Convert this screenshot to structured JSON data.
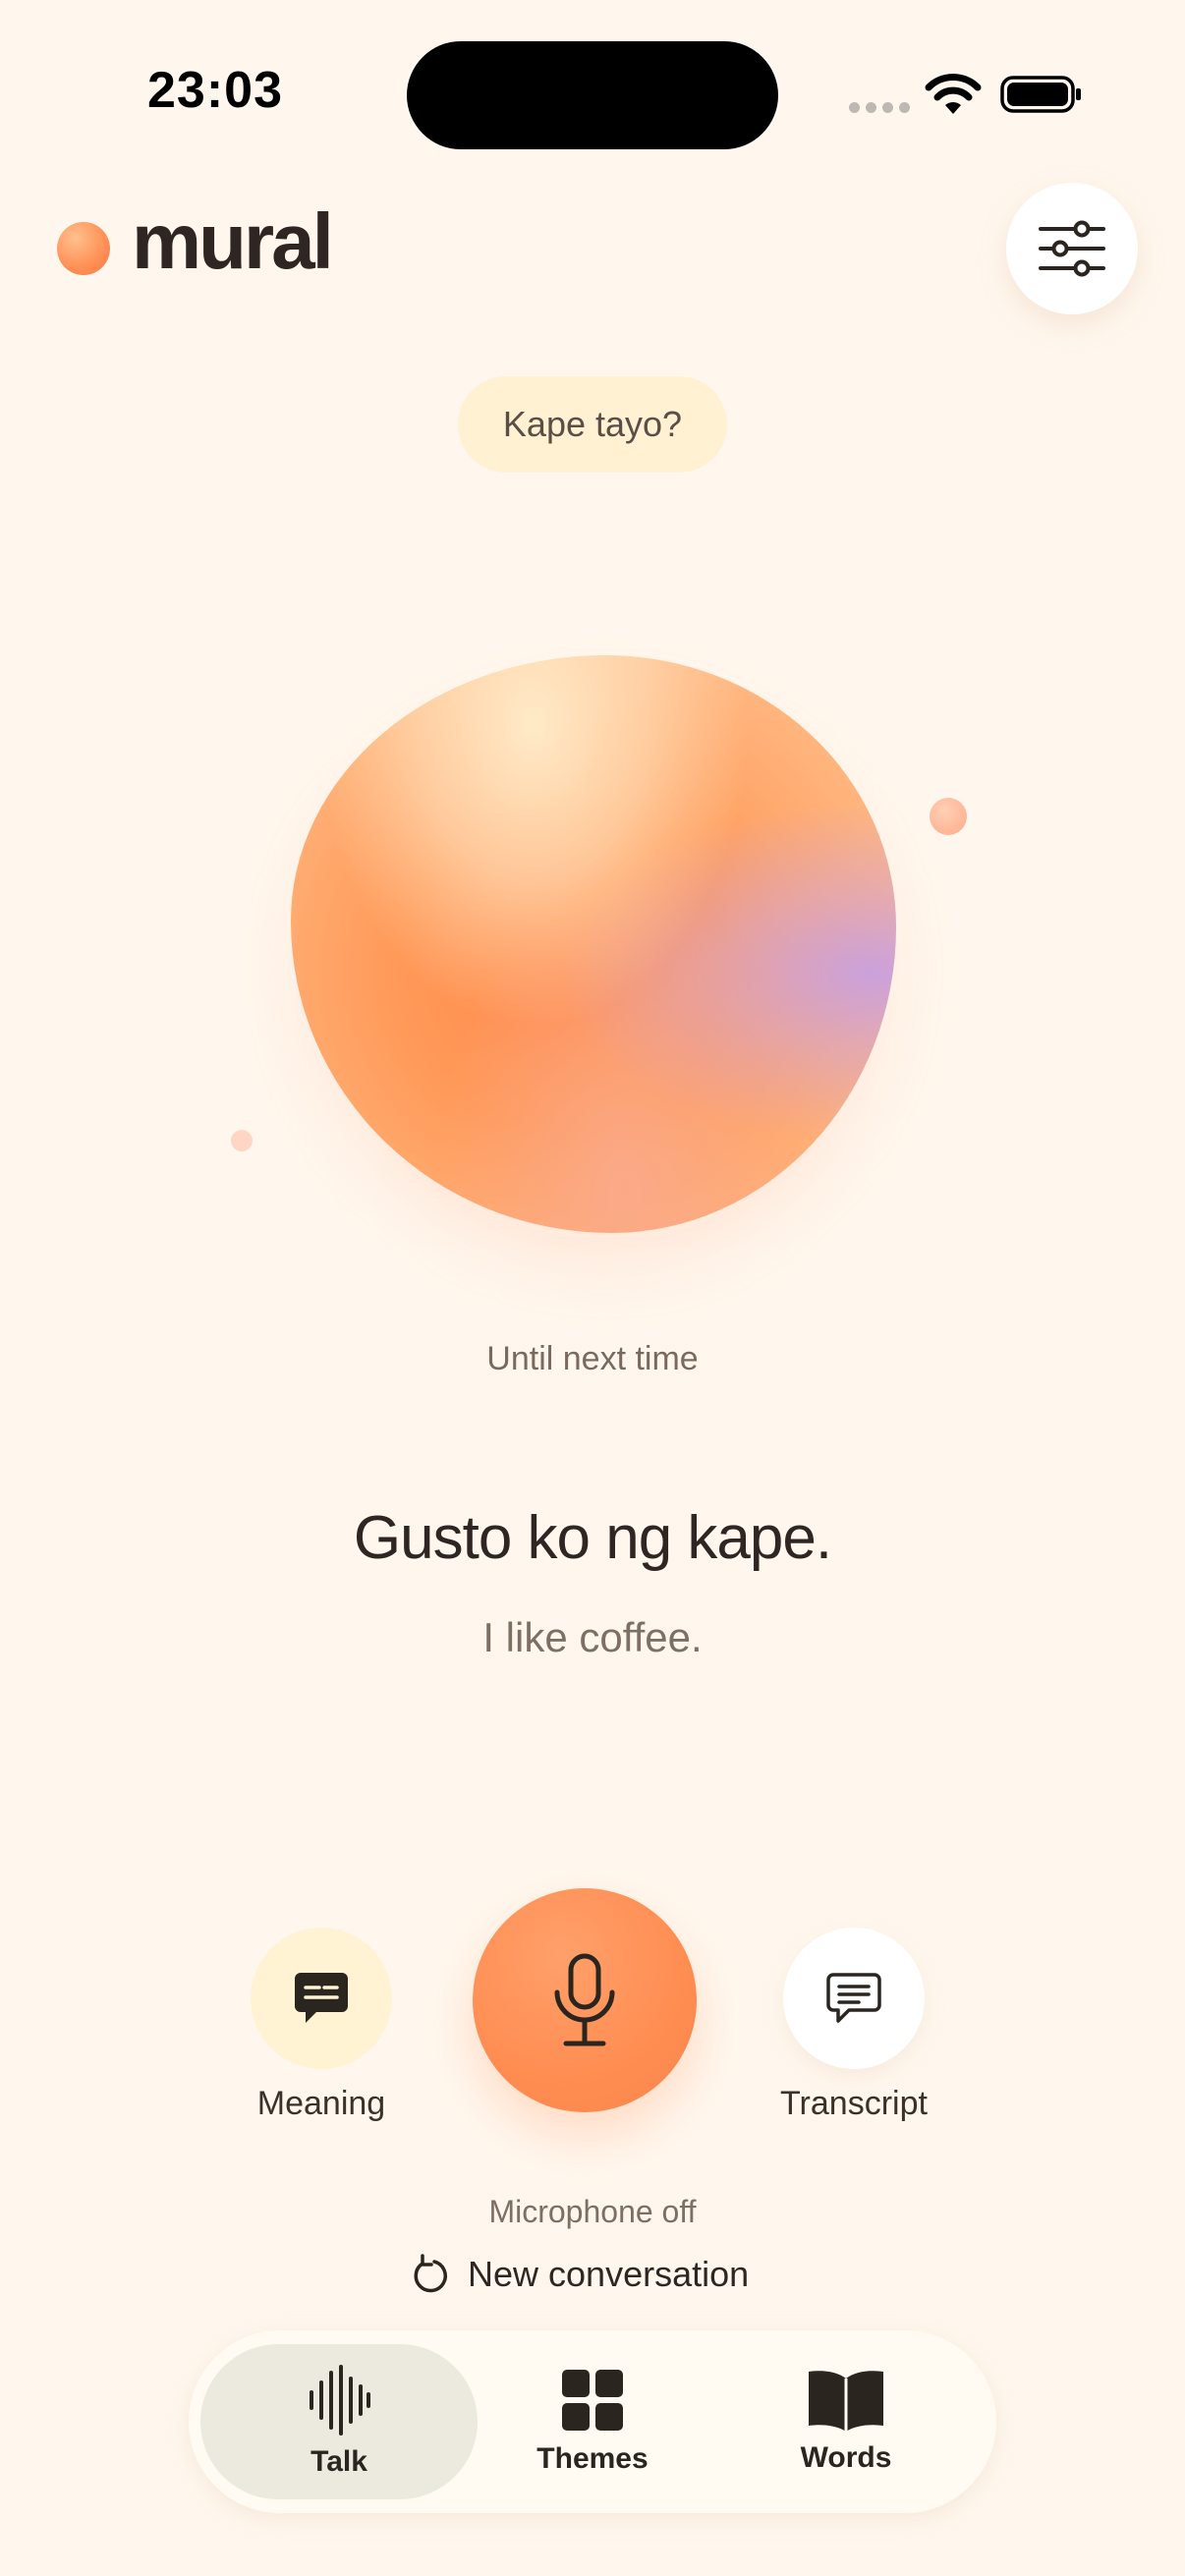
{
  "status_bar": {
    "time": "23:03"
  },
  "header": {
    "app_name": "mural",
    "settings_icon": "sliders-icon"
  },
  "prompt_chip": "Kape tayo?",
  "conversation": {
    "status": "Until next time",
    "phrase": "Gusto ko ng kape.",
    "translation": "I like coffee."
  },
  "controls": {
    "meaning_label": "Meaning",
    "transcript_label": "Transcript",
    "mic_status": "Microphone off",
    "new_conversation_label": "New conversation"
  },
  "tabs": [
    {
      "label": "Talk",
      "icon": "waveform-icon",
      "active": true
    },
    {
      "label": "Themes",
      "icon": "grid-icon",
      "active": false
    },
    {
      "label": "Words",
      "icon": "book-icon",
      "active": false
    }
  ],
  "colors": {
    "background": "#FFF7EE",
    "accent": "#FF8D52",
    "chip": "#FFF1D2",
    "active_tab": "#ECEADF"
  }
}
